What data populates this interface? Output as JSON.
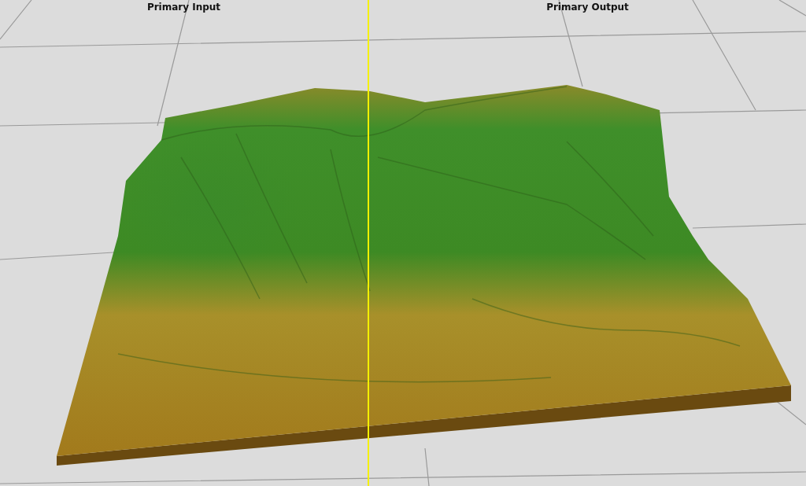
{
  "panes": [
    {
      "label": "Primary Input"
    },
    {
      "label": "Primary Output"
    }
  ]
}
